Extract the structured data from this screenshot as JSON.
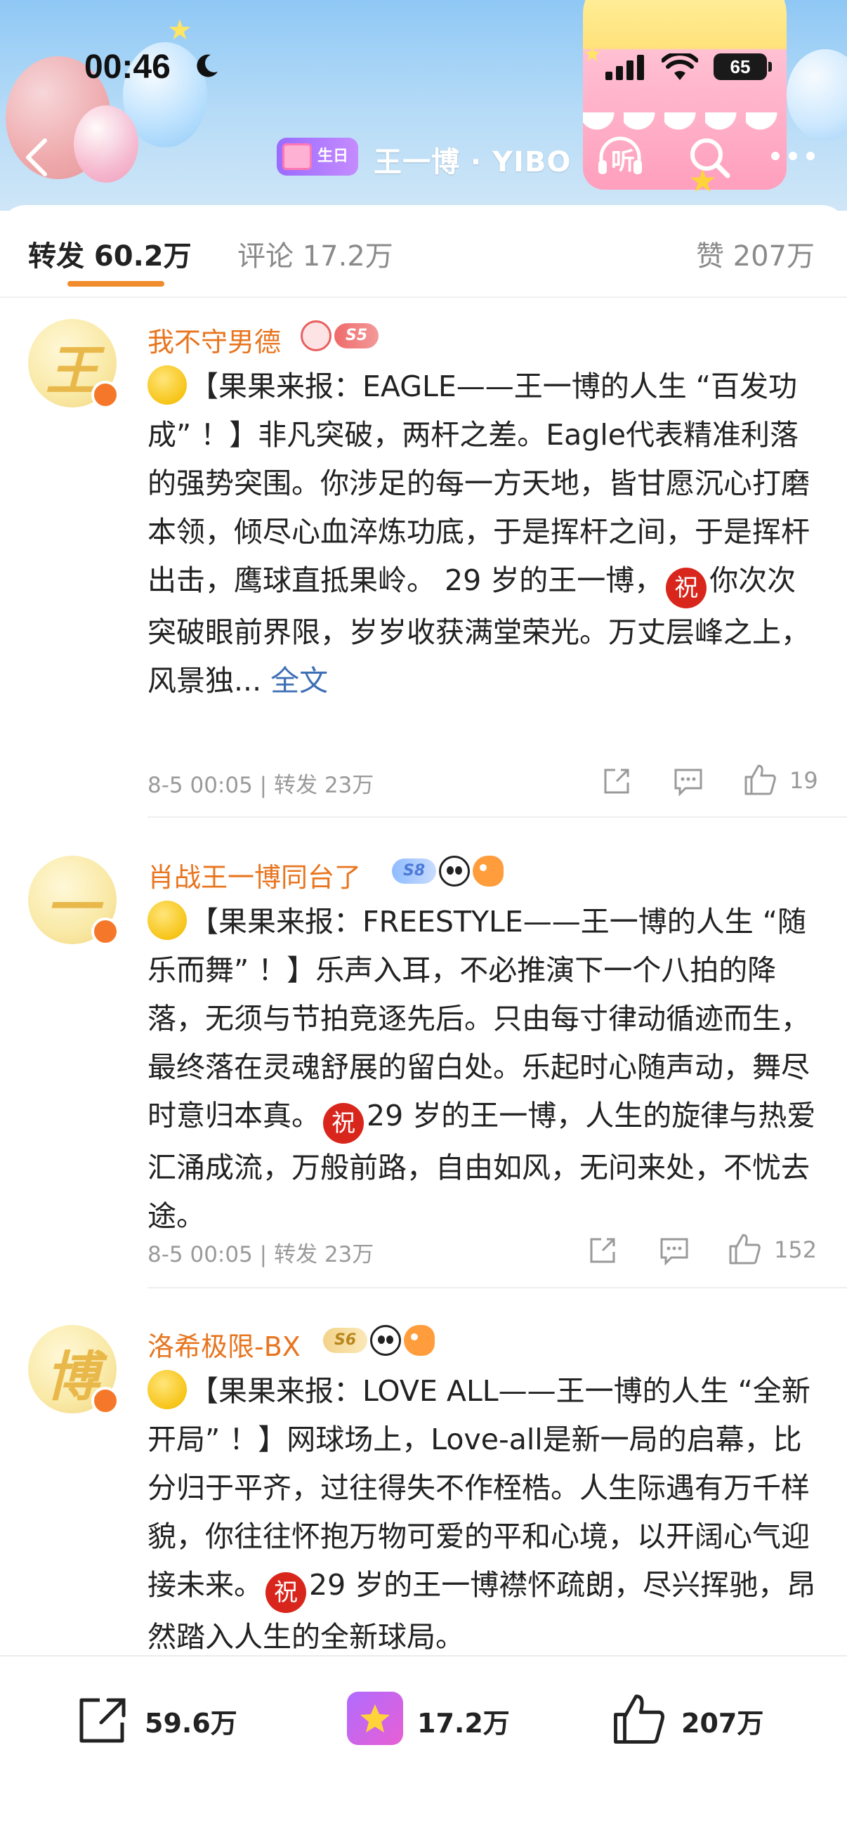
{
  "status_bar": {
    "time": "00:46",
    "battery": "65"
  },
  "header": {
    "badge_label": "生日",
    "title": "王一博 · YIBO",
    "listen_label": "听"
  },
  "tabs": [
    {
      "label": "转发 60.2万"
    },
    {
      "label": "评论 17.2万"
    },
    {
      "label": "赞 207万"
    }
  ],
  "posts": [
    {
      "avatar_char": "王",
      "username": "我不守男德",
      "badge_level": "S5",
      "text_before": "【果果来报：EAGLE——王一博的人生 “百发功成” ！】非凡突破，两杆之差。Eagle代表精准利落的强势突围。你涉足的每一方天地，皆甘愿沉心打磨本领，倾尽心血淬炼功底，于是挥杆之间，于是挥杆出击，鹰球直抵果岭。 29 岁的王一博，",
      "zhu": "祝",
      "text_after": "你次次突破眼前界限，岁岁收获满堂荣光。万丈层峰之上，风景独...",
      "fulltext_label": "全文",
      "meta": "8-5 00:05 | 转发 23万",
      "likes": "19"
    },
    {
      "avatar_char": "一",
      "username": "肖战王一博同台了",
      "badge_level": "S8",
      "text_before": "【果果来报：FREESTYLE——王一博的人生 “随乐而舞” ！】乐声入耳，不必推演下一个八拍的降落，无须与节拍竞逐先后。只由每寸律动循迹而生，最终落在灵魂舒展的留白处。乐起时心随声动，舞尽时意归本真。",
      "zhu": "祝",
      "text_after": "29 岁的王一博，人生的旋律与热爱汇涌成流，万般前路，自由如风，无问来处，不忧去途。",
      "meta": "8-5 00:05 | 转发 23万",
      "likes": "152"
    },
    {
      "avatar_char": "博",
      "username": "洛希极限-BX",
      "badge_level": "S6",
      "text_before": "【果果来报：LOVE ALL——王一博的人生 “全新开局” ！】网球场上，Love-all是新一局的启幕，比分归于平齐，过往得失不作桎梏。人生际遇有万千样貌，你往往怀抱万物可爱的平和心境，以开阔心气迎接未来。",
      "zhu": "祝",
      "text_after": "29 岁的王一博襟怀疏朗，尽兴挥驰，昂然踏入人生的全新球局。"
    }
  ],
  "bottom_bar": {
    "repost_count": "59.6万",
    "comment_count": "17.2万",
    "like_count": "207万"
  },
  "colors": {
    "accent": "#f08c2c",
    "username": "#e8751f",
    "link": "#3d6fb6",
    "zhu_red": "#d9261c"
  }
}
